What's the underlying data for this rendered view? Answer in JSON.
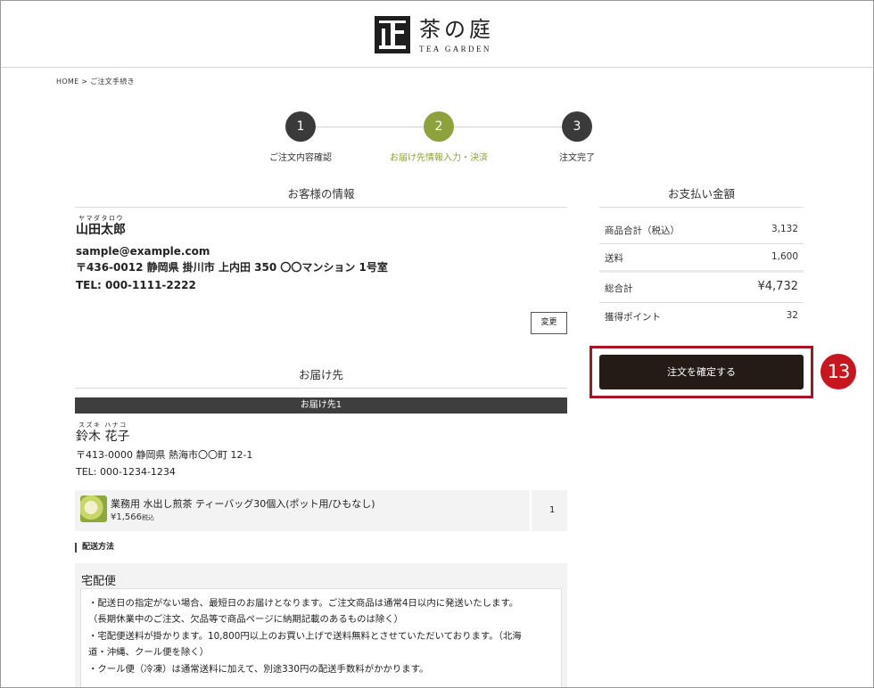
{
  "header": {
    "logo_jp": "茶の庭",
    "logo_en": "TEA GARDEN"
  },
  "breadcrumb": "HOME > ご注文手続き",
  "steps": [
    {
      "number": "1",
      "label": "ご注文内容確認",
      "color": "#3a3a3a"
    },
    {
      "number": "2",
      "label": "お届け先情報入力・決済",
      "color": "#8da23c"
    },
    {
      "number": "3",
      "label": "注文完了",
      "color": "#3a3a3a"
    }
  ],
  "customer": {
    "section_title": "お客様の情報",
    "ruby": "ヤマダタロウ",
    "name": "山田太郎",
    "email": "sample@example.com",
    "address": "〒436-0012 静岡県 掛川市 上内田 350 〇〇マンション 1号室",
    "tel": "TEL: 000-1111-2222",
    "change_label": "変更"
  },
  "delivery": {
    "section_title": "お届け先",
    "bar_label": "お届け先1",
    "ruby": "スズキ ハナコ",
    "name": "鈴木 花子",
    "address": "〒413-0000 静岡県 熱海市〇〇町 12-1",
    "tel": "TEL: 000-1234-1234",
    "product": {
      "name": "業務用 水出し煎茶 ティーバッグ30個入(ポット用/ひもなし)",
      "price": "¥1,566",
      "price_suffix": "税込",
      "qty": "1"
    },
    "shipping_title": "配送方法",
    "shipping_method": "宅配便",
    "notes": [
      "・配送日の指定がない場合、最短日のお届けとなります。ご注文商品は通常4日以内に発送いたします。",
      "（長期休業中のご注文、欠品等で商品ページに納期記載のあるものは除く）",
      "・宅配便送料が掛かります。10,800円以上のお買い上げで送料無料とさせていただいております。（北海",
      "道・沖縄、クール便を除く）",
      "・クール便（冷凍）は通常送料に加えて、別途330円の配送手数料がかかります。"
    ]
  },
  "payment": {
    "section_title": "お支払い金額",
    "subtotal_label": "商品合計（税込）",
    "subtotal_value": "3,132",
    "shipping_label": "送料",
    "shipping_value": "1,600",
    "total_label": "総合計",
    "total_value": "¥4,732",
    "points_label": "獲得ポイント",
    "points_value": "32",
    "confirm_label": "注文を確定する"
  },
  "annotation": {
    "marker": "13",
    "color": "#c8161e"
  }
}
